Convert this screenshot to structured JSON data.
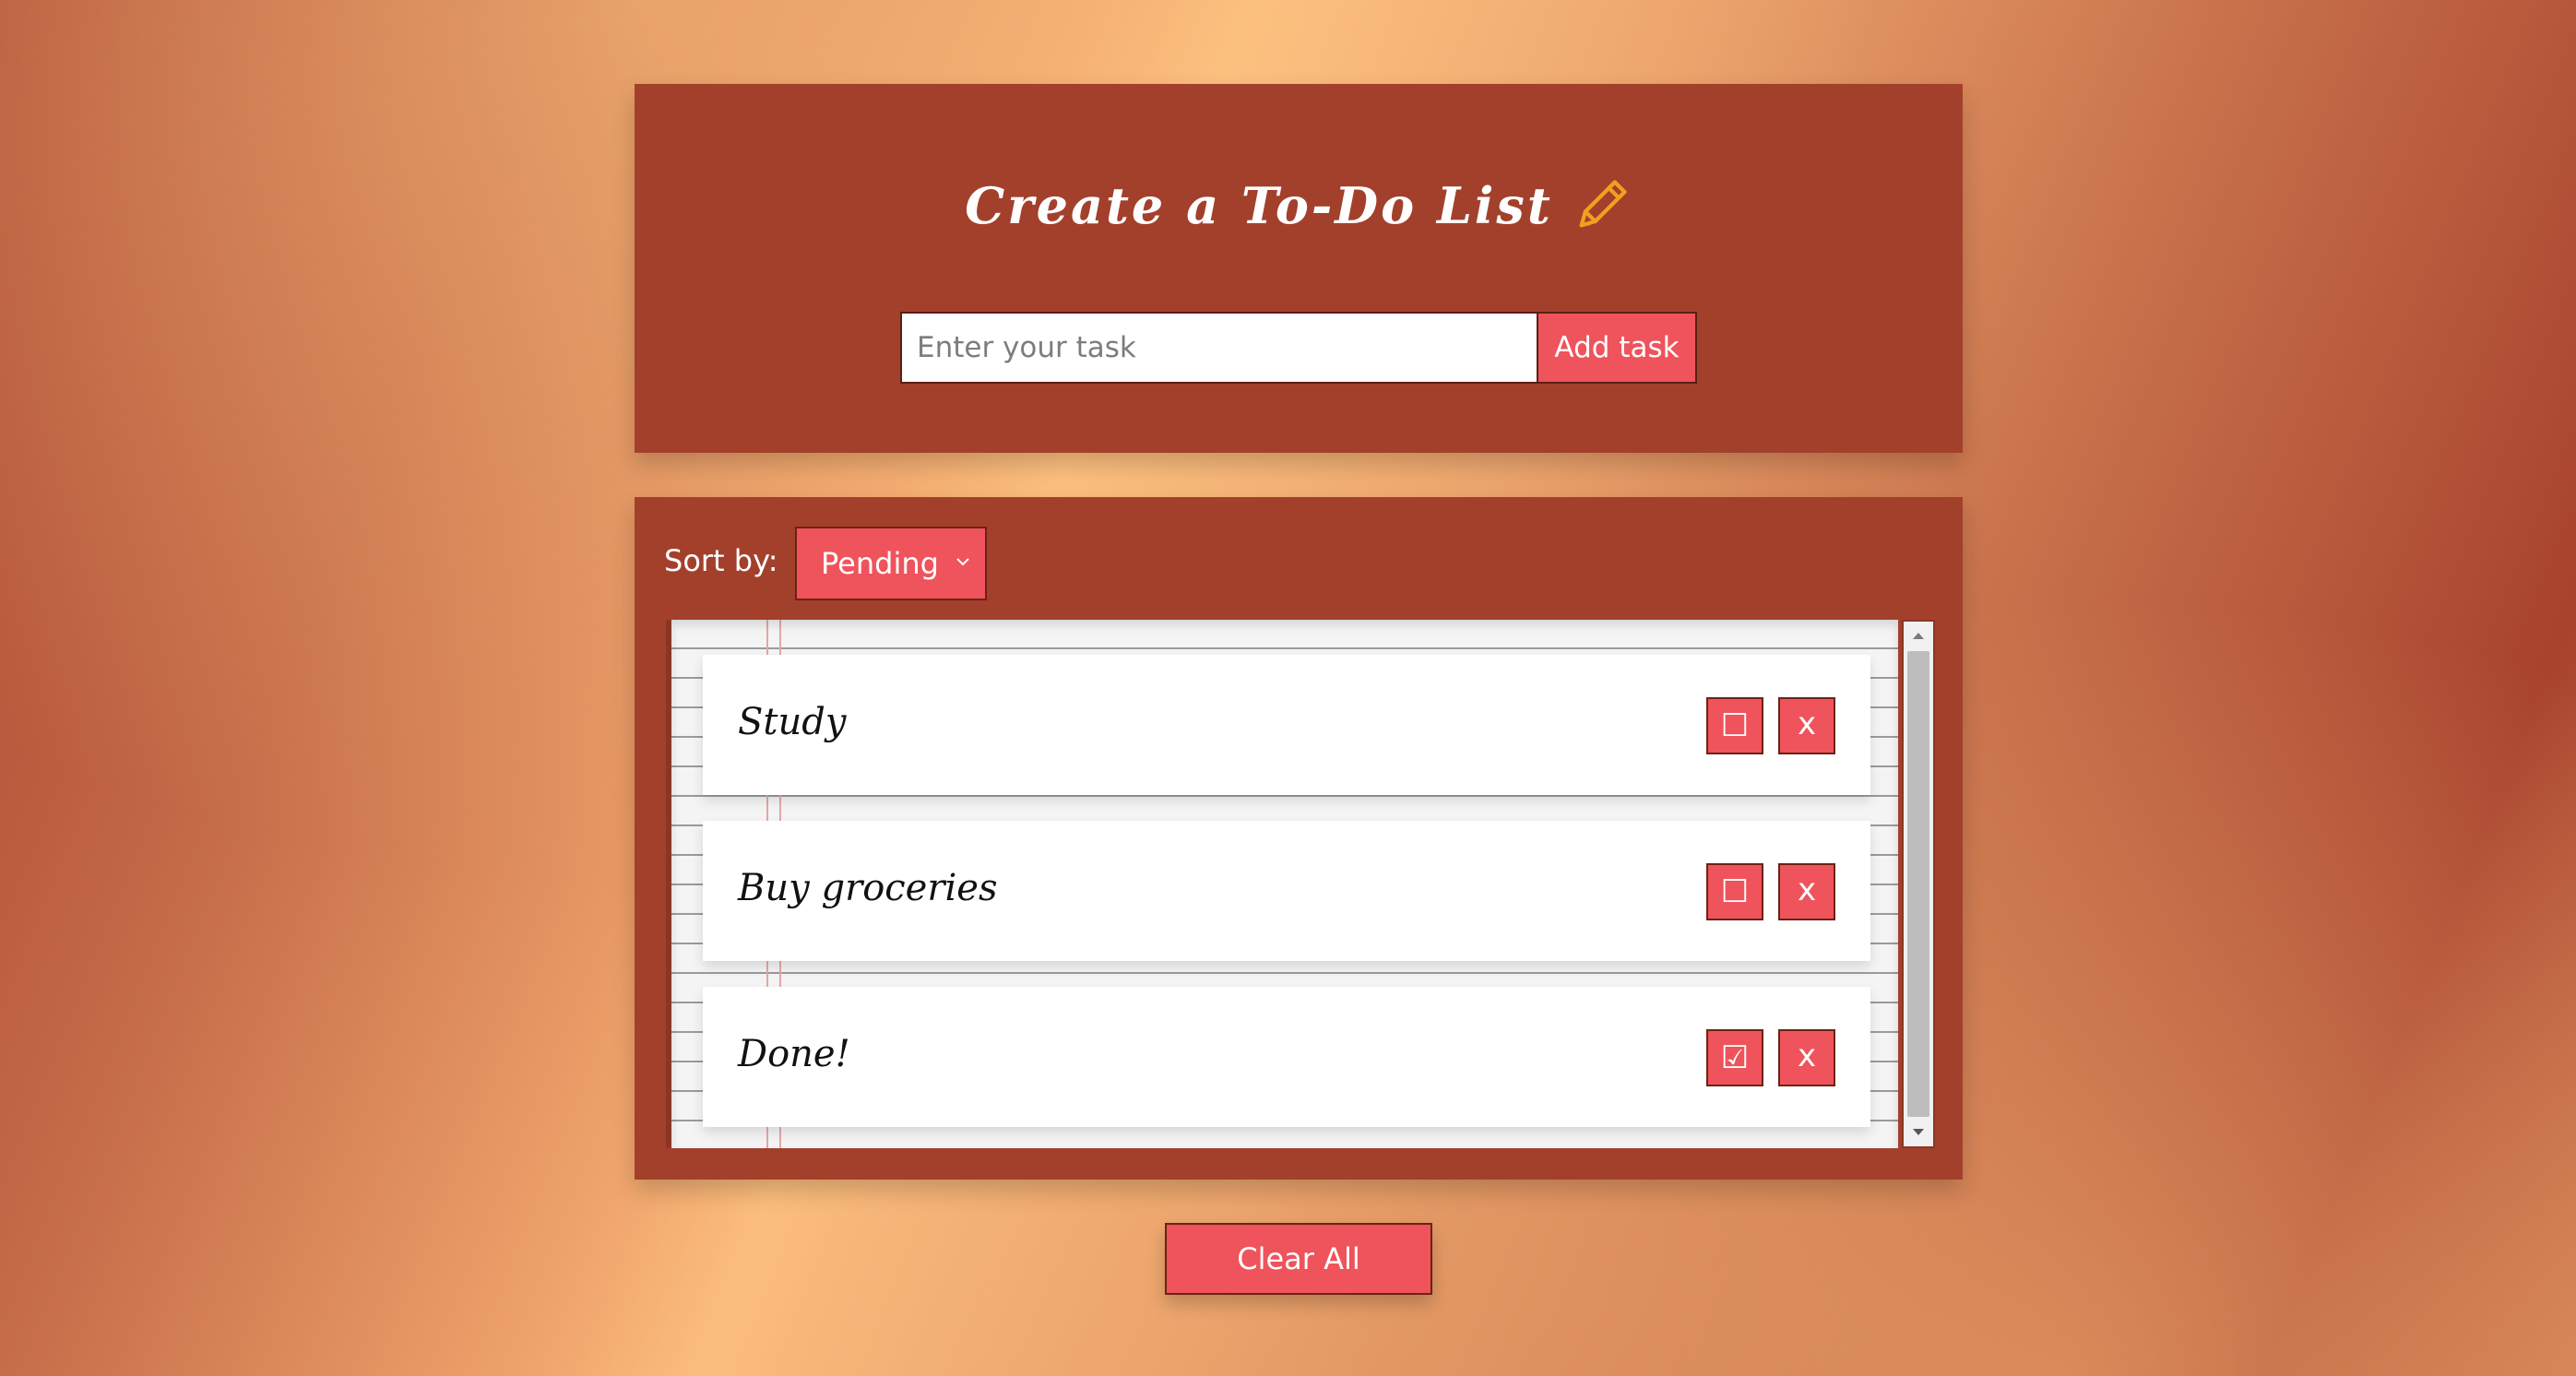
{
  "header": {
    "title": "Create a To-Do List",
    "title_icon": "pencil-icon",
    "input_placeholder": "Enter your task",
    "input_value": "",
    "add_button_label": "Add task"
  },
  "list_panel": {
    "sort_label": "Sort by:",
    "sort_selected": "Pending",
    "tasks": [
      {
        "text": "Study",
        "checked": false,
        "check_glyph": "☐",
        "delete_label": "x"
      },
      {
        "text": "Buy groceries",
        "checked": false,
        "check_glyph": "☐",
        "delete_label": "x"
      },
      {
        "text": "Done!",
        "checked": true,
        "check_glyph": "☑",
        "delete_label": "x"
      }
    ]
  },
  "footer": {
    "clear_button_label": "Clear All"
  },
  "colors": {
    "panel": "#a3402c",
    "button": "#ef535c",
    "pencil": "#f0a020"
  }
}
